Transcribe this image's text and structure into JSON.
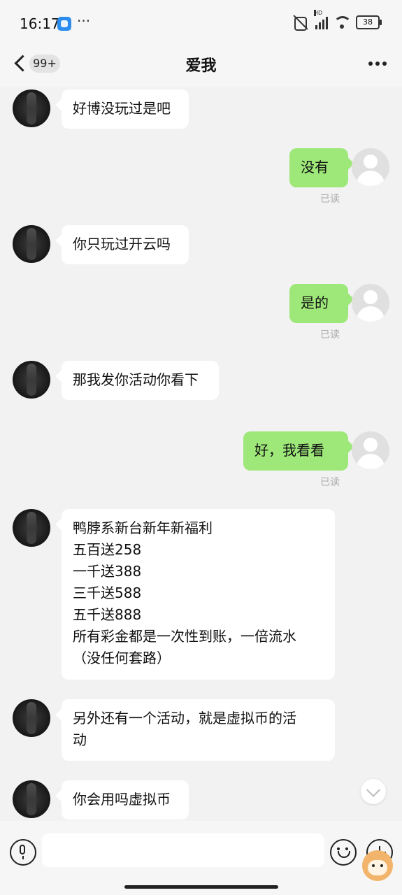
{
  "status": {
    "time": "16:17",
    "battery": "38"
  },
  "nav": {
    "unread_badge": "99+",
    "title": "爱我"
  },
  "messages": [
    {
      "side": "left",
      "text": "好博没玩过是吧"
    },
    {
      "side": "right",
      "text": "没有",
      "read": "已读"
    },
    {
      "side": "left",
      "text": "你只玩过开云吗"
    },
    {
      "side": "right",
      "text": "是的",
      "read": "已读"
    },
    {
      "side": "left",
      "text": "那我发你活动你看下"
    },
    {
      "side": "right",
      "text": "好，我看看",
      "read": "已读"
    },
    {
      "side": "left",
      "text": "鸭脖系新台新年新福利\n五百送258\n一千送388\n三千送588\n五千送888\n 所有彩金都是一次性到账，一倍流水\n（没任何套路）"
    },
    {
      "side": "left",
      "text": "另外还有一个活动，就是虚拟币的活\n动"
    },
    {
      "side": "left",
      "text": "你会用吗虚拟币"
    }
  ],
  "input": {
    "placeholder": ""
  },
  "colors": {
    "sent_bubble": "#9ee87a",
    "received_bubble": "#ffffff",
    "background": "#f2f2f2"
  }
}
